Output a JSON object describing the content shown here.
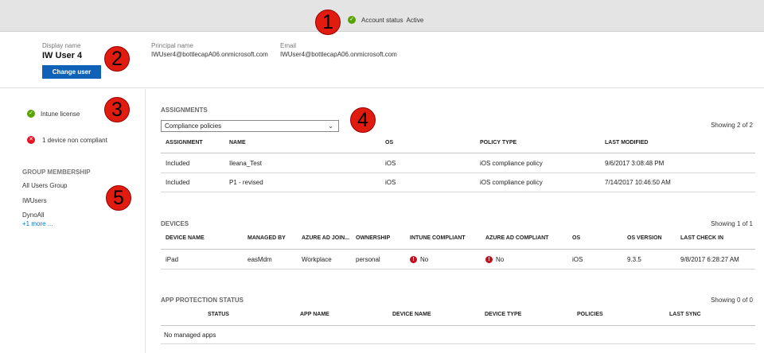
{
  "status_bar": {
    "label": "Account status",
    "value": "Active",
    "icon": "check-circle-icon"
  },
  "callouts": [
    "1",
    "2",
    "3",
    "4",
    "5"
  ],
  "user": {
    "display_name_label": "Display name",
    "display_name": "IW User 4",
    "change_user_label": "Change user",
    "principal_label": "Principal name",
    "principal": "IWUser4@bottlecapA06.onmicrosoft.com",
    "email_label": "Email",
    "email": "IWUser4@bottlecapA06.onmicrosoft.com"
  },
  "license": {
    "intune": "Intune license",
    "noncompliant": "1 device non compliant"
  },
  "groups": {
    "title": "GROUP MEMBERSHIP",
    "items": [
      "All Users Group",
      "IWUsers",
      "DynoAll"
    ],
    "more": "+1 more ..."
  },
  "assignments": {
    "title": "ASSIGNMENTS",
    "filter": "Compliance policies",
    "showing": "Showing 2 of 2",
    "columns": [
      "ASSIGNMENT",
      "NAME",
      "OS",
      "POLICY TYPE",
      "LAST MODIFIED"
    ],
    "rows": [
      [
        "Included",
        "Ileana_Test",
        "iOS",
        "iOS compliance policy",
        "9/6/2017 3:08:48 PM"
      ],
      [
        "Included",
        "P1 - revised",
        "iOS",
        "iOS compliance policy",
        "7/14/2017 10:46:50 AM"
      ]
    ]
  },
  "devices": {
    "title": "DEVICES",
    "showing": "Showing 1 of 1",
    "columns": [
      "DEVICE NAME",
      "MANAGED BY",
      "AZURE AD JOIN...",
      "OWNERSHIP",
      "INTUNE COMPLIANT",
      "AZURE AD COMPLIANT",
      "OS",
      "OS VERSION",
      "LAST CHECK IN"
    ],
    "rows": [
      [
        "iPad",
        "easMdm",
        "Workplace",
        "personal",
        "No",
        "No",
        "iOS",
        "9.3.5",
        "9/8/2017 6:28:27 AM"
      ]
    ]
  },
  "app_protection": {
    "title": "APP PROTECTION STATUS",
    "showing": "Showing 0 of 0",
    "columns": [
      "STATUS",
      "APP NAME",
      "DEVICE NAME",
      "DEVICE TYPE",
      "POLICIES",
      "LAST SYNC"
    ],
    "empty": "No managed apps"
  },
  "colors": {
    "accent": "#0f62b8",
    "success": "#57a300",
    "error": "#e81123",
    "callout": "#e01b0f"
  }
}
